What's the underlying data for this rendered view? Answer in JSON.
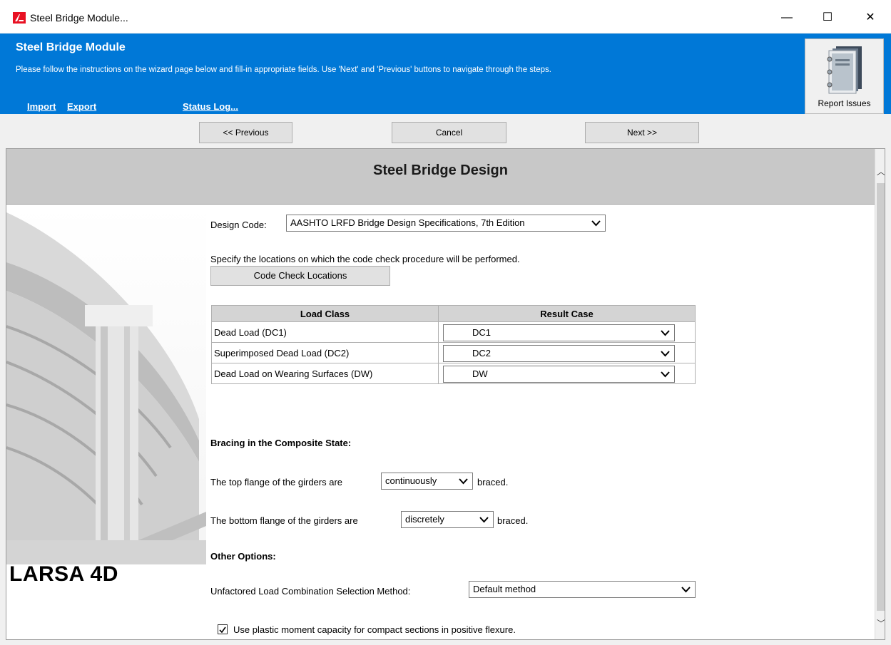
{
  "window": {
    "title": "Steel Bridge Module...",
    "minimize_glyph": "—",
    "maximize_glyph": "☐",
    "close_glyph": "✕"
  },
  "header": {
    "title": "Steel Bridge Module",
    "instructions": "Please follow the instructions on the wizard page below and fill-in appropriate fields. Use 'Next' and 'Previous' buttons to navigate through the steps.",
    "links": {
      "import": "Import",
      "export": "Export",
      "status_log": "Status Log..."
    },
    "report_issues": "Report Issues"
  },
  "nav": {
    "previous": "<< Previous",
    "cancel": "Cancel",
    "next": "Next >>"
  },
  "panel": {
    "title": "Steel Bridge Design",
    "side_caption": "LARSA 4D"
  },
  "form": {
    "design_code_label": "Design Code:",
    "design_code_value": "AASHTO LRFD Bridge Design Specifications, 7th Edition",
    "locations_instruction": "Specify the locations on which the code check procedure will be performed.",
    "code_check_button": "Code Check Locations",
    "load_table": {
      "headers": [
        "Load Class",
        "Result Case"
      ],
      "rows": [
        {
          "load_class": "Dead Load (DC1)",
          "result_case": "DC1"
        },
        {
          "load_class": "Superimposed Dead Load (DC2)",
          "result_case": "DC2"
        },
        {
          "load_class": "Dead Load on Wearing Surfaces (DW)",
          "result_case": "DW"
        }
      ]
    },
    "bracing_heading": "Bracing in the Composite State:",
    "top_flange_prefix": "The top flange of the girders are",
    "top_flange_value": "continuously",
    "bottom_flange_prefix": "The bottom flange of the girders are",
    "bottom_flange_value": "discretely",
    "braced_suffix": "braced.",
    "other_heading": "Other Options:",
    "combination_label": "Unfactored Load Combination Selection Method:",
    "combination_value": "Default method",
    "plastic_moment_label": "Use plastic moment capacity for compact sections in positive flexure.",
    "plastic_moment_checked": true
  },
  "colors": {
    "header_blue": "#0078d7",
    "panel_header_gray": "#c8c8c8",
    "logo_red": "#e81123"
  }
}
